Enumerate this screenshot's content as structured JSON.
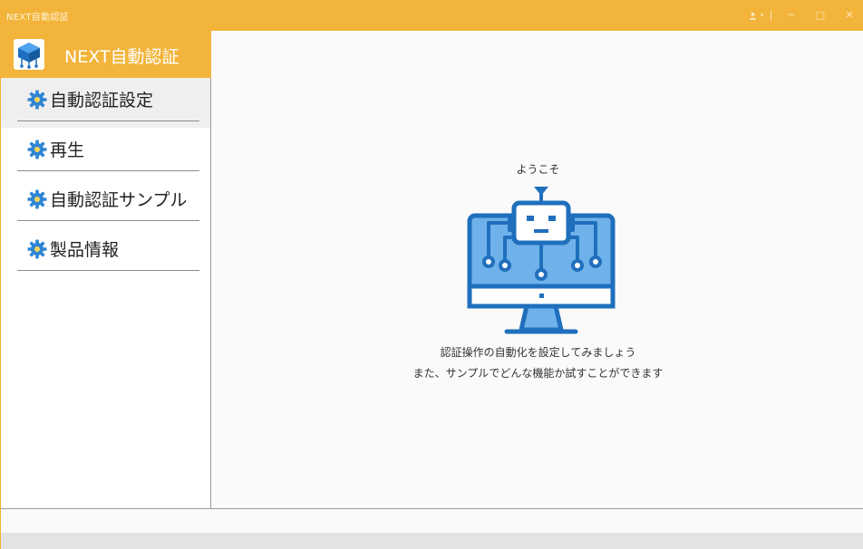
{
  "window": {
    "title": "NEXT自動認証",
    "controls": {
      "user_caret": "▾",
      "minimize": "─",
      "maximize": "□",
      "close": "✕"
    }
  },
  "sidebar": {
    "brand": "NEXT自動認証",
    "items": [
      {
        "label": "自動認証設定",
        "icon": "gear-icon",
        "active": true
      },
      {
        "label": "再生",
        "icon": "gear-icon",
        "active": false
      },
      {
        "label": "自動認証サンプル",
        "icon": "gear-icon",
        "active": false
      },
      {
        "label": "製品情報",
        "icon": "gear-icon",
        "active": false
      }
    ]
  },
  "main": {
    "welcome": "ようこそ",
    "illustration": "robot-monitor-illustration",
    "message_line1": "認証操作の自動化を設定してみましょう",
    "message_line2": "また、サンプルでどんな機能か試すことができます"
  },
  "colors": {
    "accent": "#f2b43a",
    "gear": "#2e86d4",
    "illustration_blue": "#1f6fbd",
    "illustration_fill": "#6fb1ea"
  }
}
